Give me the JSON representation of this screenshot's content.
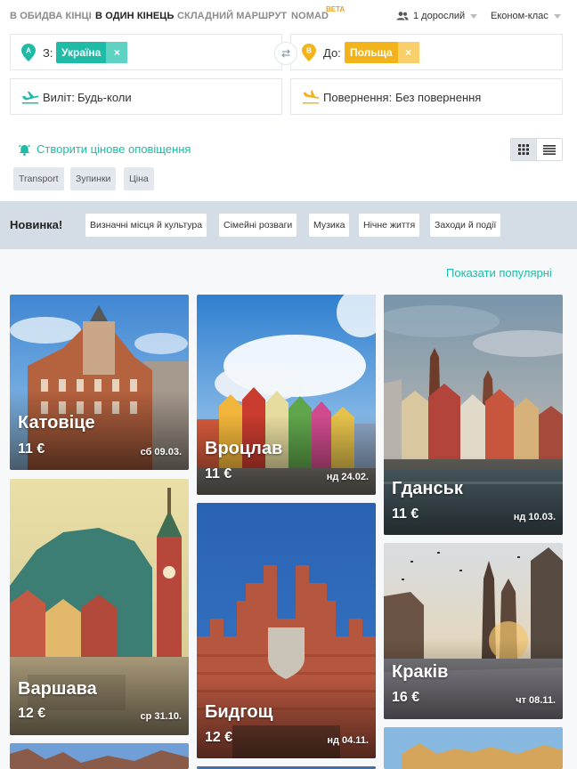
{
  "nav": {
    "tabs": [
      "В ОБИДВА КІНЦІ",
      "В ОДИН КІНЕЦЬ",
      "СКЛАДНИЙ МАРШРУТ",
      "NOMAD"
    ],
    "beta": "BETA",
    "passengers": "1 дорослий",
    "cabin_class": "Економ-клас"
  },
  "search": {
    "from_label": "З:",
    "from_value": "Україна",
    "from_pin": "A",
    "to_label": "До:",
    "to_value": "Польща",
    "to_pin": "B",
    "remove_icon": "×",
    "departure_label": "Виліт:",
    "departure_value": "Будь-коли",
    "return_label": "Повернення:",
    "return_value": "Без повернення"
  },
  "alert": {
    "label": "Створити цінове оповіщення"
  },
  "filters": [
    "Transport",
    "Зупинки",
    "Ціна"
  ],
  "novinka": {
    "title": "Новинка!",
    "categories": [
      "Визначні місця й культура",
      "Сімейні розваги",
      "Музика",
      "Нічне життя",
      "Заходи й події"
    ]
  },
  "show_popular": "Показати популярні",
  "cards": [
    {
      "city": "Катовіце",
      "price": "11 €",
      "date": "сб 09.03."
    },
    {
      "city": "Вроцлав",
      "price": "11 €",
      "date": "нд 24.02."
    },
    {
      "city": "Гданськ",
      "price": "11 €",
      "date": "нд 10.03."
    },
    {
      "city": "Варшава",
      "price": "12 €",
      "date": "ср 31.10."
    },
    {
      "city": "Бидгощ",
      "price": "12 €",
      "date": "нд 04.11."
    },
    {
      "city": "Краків",
      "price": "16 €",
      "date": "чт 08.11."
    }
  ],
  "colors": {
    "accent": "#1fbba6",
    "to_chip": "#f3b31a",
    "band": "#d4dde5"
  }
}
